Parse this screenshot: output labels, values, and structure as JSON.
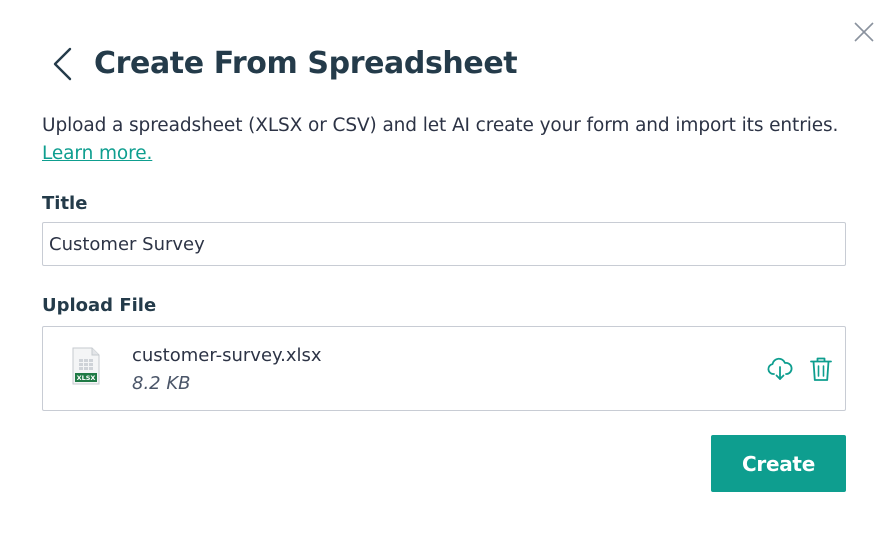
{
  "dialog": {
    "title": "Create From Spreadsheet",
    "description": "Upload a spreadsheet (XLSX or CSV) and let AI create your form and import its entries.",
    "learn_more_label": "Learn more."
  },
  "title_field": {
    "label": "Title",
    "value": "Customer Survey"
  },
  "upload": {
    "label": "Upload File",
    "file_name": "customer-survey.xlsx",
    "file_size": "8.2 KB",
    "file_badge": "XLSX"
  },
  "actions": {
    "create_label": "Create"
  },
  "icons": {
    "close": "close-icon",
    "back": "chevron-left-icon",
    "file": "spreadsheet-file-icon",
    "download": "download-icon",
    "delete": "trash-icon"
  },
  "colors": {
    "accent": "#0e9e8f",
    "title_text": "#243b4a",
    "body_text": "#2c3345",
    "border": "#c8ccd4"
  }
}
